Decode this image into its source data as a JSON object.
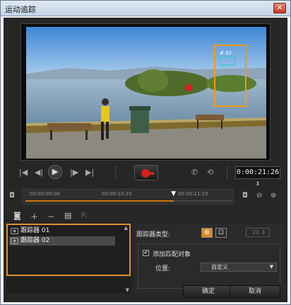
{
  "window": {
    "title": "运动追踪",
    "close_icon": "close-icon"
  },
  "preview": {
    "tracker_tag": "# 02"
  },
  "transport": {
    "timecode": "0:00:21:26",
    "icons": [
      "home-icon",
      "prev-frame-icon",
      "play-icon",
      "next-frame-icon",
      "end-icon",
      "record-icon",
      "phone-icon",
      "history-icon"
    ]
  },
  "timeline": {
    "labels": [
      "00:00:00:00",
      "00:00:10:20",
      "00:00:21:10"
    ],
    "progress": 0.72
  },
  "trackers": {
    "items": [
      {
        "label": "跟踪器 01",
        "selected": false
      },
      {
        "label": "跟踪器 02",
        "selected": true
      }
    ]
  },
  "props": {
    "type_label": "跟踪器类型:",
    "spin_value": "20",
    "add_match_label": "添加匹配对象",
    "add_match_checked": true,
    "position_label": "位置:",
    "position_value": "自定义"
  },
  "buttons": {
    "ok": "确定",
    "cancel": "取消"
  },
  "colors": {
    "accent": "#e0902a",
    "record": "#d62020",
    "tracker_box": "#27d0c8"
  }
}
